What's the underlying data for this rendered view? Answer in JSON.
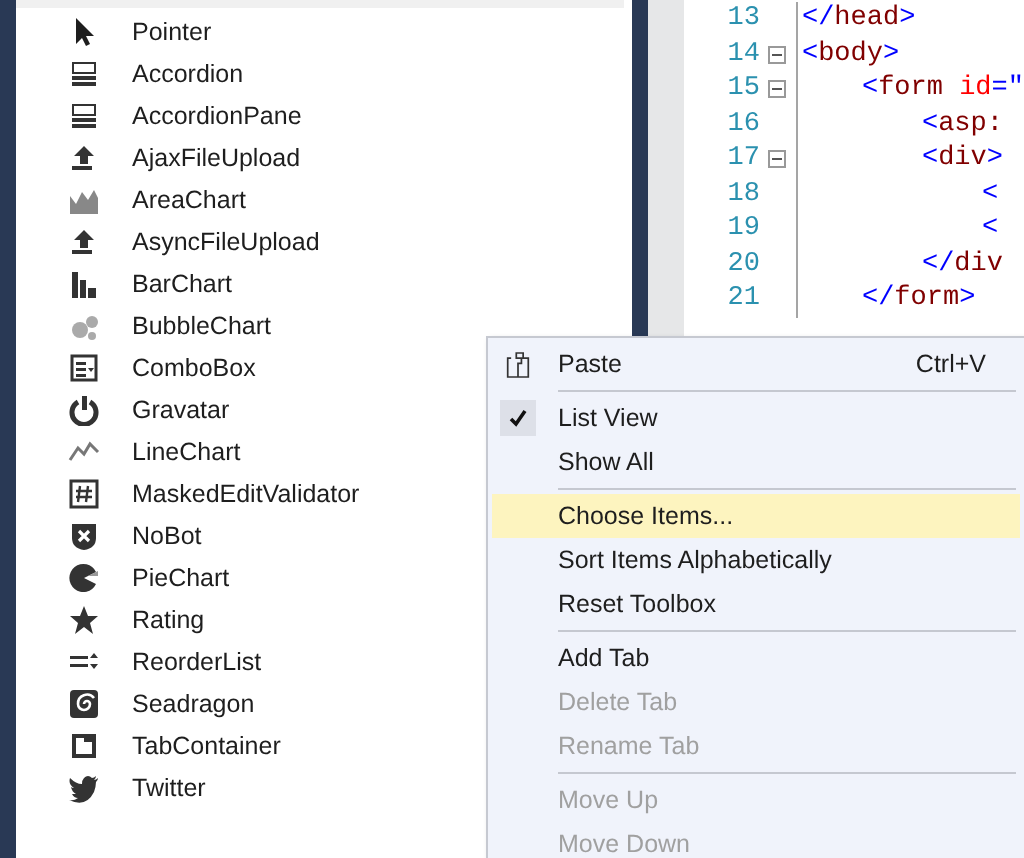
{
  "toolbox": {
    "items": [
      {
        "label": "Pointer"
      },
      {
        "label": "Accordion"
      },
      {
        "label": "AccordionPane"
      },
      {
        "label": "AjaxFileUpload"
      },
      {
        "label": "AreaChart"
      },
      {
        "label": "AsyncFileUpload"
      },
      {
        "label": "BarChart"
      },
      {
        "label": "BubbleChart"
      },
      {
        "label": "ComboBox"
      },
      {
        "label": "Gravatar"
      },
      {
        "label": "LineChart"
      },
      {
        "label": "MaskedEditValidator"
      },
      {
        "label": "NoBot"
      },
      {
        "label": "PieChart"
      },
      {
        "label": "Rating"
      },
      {
        "label": "ReorderList"
      },
      {
        "label": "Seadragon"
      },
      {
        "label": "TabContainer"
      },
      {
        "label": "Twitter"
      }
    ]
  },
  "editor": {
    "lines": [
      {
        "number": "13",
        "fold": false,
        "tokens": [
          {
            "text": "</",
            "kind": "punct"
          },
          {
            "text": "head",
            "kind": "tag"
          },
          {
            "text": ">",
            "kind": "punct"
          }
        ]
      },
      {
        "number": "14",
        "fold": true,
        "tokens": [
          {
            "text": "<",
            "kind": "punct"
          },
          {
            "text": "body",
            "kind": "tag"
          },
          {
            "text": ">",
            "kind": "punct"
          }
        ],
        "children": [
          {
            "number": "15",
            "fold": true,
            "tokens": [
              {
                "text": "<",
                "kind": "punct"
              },
              {
                "text": "form",
                "kind": "tag"
              },
              {
                "text": " id",
                "kind": "attr"
              },
              {
                "text": "=\"",
                "kind": "punct"
              }
            ],
            "children": [
              {
                "number": "16",
                "fold": false,
                "tokens": [
                  {
                    "text": "<",
                    "kind": "punct"
                  },
                  {
                    "text": "asp:",
                    "kind": "tag"
                  }
                ]
              },
              {
                "number": "17",
                "fold": true,
                "tokens": [
                  {
                    "text": "<",
                    "kind": "punct"
                  },
                  {
                    "text": "div",
                    "kind": "tag"
                  },
                  {
                    "text": ">",
                    "kind": "punct"
                  }
                ],
                "children": [
                  {
                    "number": "18",
                    "fold": false,
                    "tokens": [
                      {
                        "text": "<",
                        "kind": "punct"
                      }
                    ]
                  },
                  {
                    "number": "19",
                    "fold": false,
                    "tokens": [
                      {
                        "text": "<",
                        "kind": "punct"
                      }
                    ]
                  }
                ]
              },
              {
                "number": "20",
                "fold": false,
                "tokens": [
                  {
                    "text": "</",
                    "kind": "punct"
                  },
                  {
                    "text": "div",
                    "kind": "tag"
                  }
                ]
              }
            ]
          },
          {
            "number": "21",
            "fold": false,
            "tokens": [
              {
                "text": "</",
                "kind": "punct"
              },
              {
                "text": "form",
                "kind": "tag"
              },
              {
                "text": ">",
                "kind": "punct"
              }
            ]
          }
        ]
      }
    ]
  },
  "context_menu": {
    "entries": [
      {
        "kind": "item",
        "label": "Paste",
        "shortcut": "Ctrl+V",
        "checked": false,
        "disabled": false,
        "selected": false,
        "has_icon": true
      },
      {
        "kind": "separator"
      },
      {
        "kind": "item",
        "label": "List View",
        "checked": true,
        "disabled": false,
        "selected": false,
        "has_icon": false
      },
      {
        "kind": "item",
        "label": "Show All",
        "checked": false,
        "disabled": false,
        "selected": false,
        "has_icon": false
      },
      {
        "kind": "separator"
      },
      {
        "kind": "item",
        "label": "Choose Items...",
        "checked": false,
        "disabled": false,
        "selected": true,
        "has_icon": false
      },
      {
        "kind": "item",
        "label": "Sort Items Alphabetically",
        "checked": false,
        "disabled": false,
        "selected": false,
        "has_icon": false
      },
      {
        "kind": "item",
        "label": "Reset Toolbox",
        "checked": false,
        "disabled": false,
        "selected": false,
        "has_icon": false
      },
      {
        "kind": "separator"
      },
      {
        "kind": "item",
        "label": "Add Tab",
        "checked": false,
        "disabled": false,
        "selected": false,
        "has_icon": false
      },
      {
        "kind": "item",
        "label": "Delete Tab",
        "checked": false,
        "disabled": true,
        "selected": false,
        "has_icon": false
      },
      {
        "kind": "item",
        "label": "Rename Tab",
        "checked": false,
        "disabled": true,
        "selected": false,
        "has_icon": false
      },
      {
        "kind": "separator"
      },
      {
        "kind": "item",
        "label": "Move Up",
        "checked": false,
        "disabled": true,
        "selected": false,
        "has_icon": false
      },
      {
        "kind": "item",
        "label": "Move Down",
        "checked": false,
        "disabled": true,
        "selected": false,
        "has_icon": false
      }
    ]
  }
}
